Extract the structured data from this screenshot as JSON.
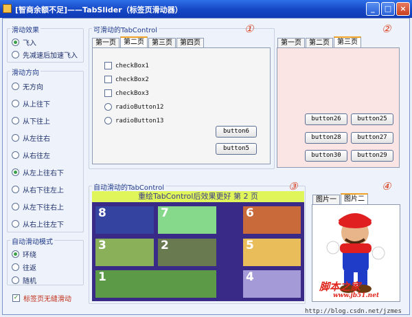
{
  "window": {
    "title": "[智商余额不足]——TabSlider（标签页滑动器）",
    "buttons": {
      "minimize": "_",
      "maximize": "□",
      "close": "×"
    }
  },
  "left": {
    "effect": {
      "title": "滑动效果",
      "options": [
        {
          "label": "飞入",
          "checked": true
        },
        {
          "label": "先减速后加速飞入",
          "checked": false
        }
      ]
    },
    "direction": {
      "title": "滑动方向",
      "options": [
        {
          "label": "无方向",
          "checked": false
        },
        {
          "label": "从上往下",
          "checked": false
        },
        {
          "label": "从下往上",
          "checked": false
        },
        {
          "label": "从左往右",
          "checked": false
        },
        {
          "label": "从右往左",
          "checked": false
        },
        {
          "label": "从左上往右下",
          "checked": true
        },
        {
          "label": "从右下往左上",
          "checked": false
        },
        {
          "label": "从左下往右上",
          "checked": false
        },
        {
          "label": "从右上往左下",
          "checked": false
        }
      ]
    },
    "mode": {
      "title": "自动滑动模式",
      "options": [
        {
          "label": "环绕",
          "checked": true
        },
        {
          "label": "往返",
          "checked": false
        },
        {
          "label": "随机",
          "checked": false
        }
      ]
    },
    "seamless": {
      "label": "标签页无缝滑动",
      "checked": true
    }
  },
  "panel1": {
    "title": "可滑动的TabControl",
    "number": "①",
    "tabs": [
      {
        "label": "第一页",
        "active": false
      },
      {
        "label": "第二页",
        "active": true
      },
      {
        "label": "第三页",
        "active": false
      },
      {
        "label": "第四页",
        "active": false
      }
    ],
    "controls": {
      "cb1": "checkBox1",
      "cb2": "checkBox2",
      "cb3": "checkBox3",
      "rb12": "radioButton12",
      "rb13": "radioButton13",
      "btn6": "button6",
      "btn5": "button5"
    }
  },
  "panel2": {
    "number": "②",
    "tabs": [
      {
        "label": "第一页",
        "active": false
      },
      {
        "label": "第二页",
        "active": false
      },
      {
        "label": "第三页",
        "active": true
      }
    ],
    "buttons": {
      "b26": "button26",
      "b25": "button25",
      "b28": "button28",
      "b27": "button27",
      "b30": "button30",
      "b29": "button29"
    }
  },
  "panel3": {
    "title": "自动滑动的TabControl",
    "number": "③",
    "header": "重绘TabControl后效果更好 第 2 页",
    "tiles": {
      "t8": "8",
      "t7": "7",
      "t6": "6",
      "t3": "3",
      "t2": "2",
      "t5": "5",
      "t1": "1",
      "t4": "4"
    }
  },
  "panel4": {
    "number": "④",
    "tabs": [
      {
        "label": "图片一",
        "active": false
      },
      {
        "label": "图片二",
        "active": true
      }
    ],
    "watermark": {
      "title": "脚本之家",
      "url": "www.jb51.net"
    }
  },
  "footer": {
    "url": "http://blog.csdn.net/jzmes"
  },
  "colors": {
    "titlebar": "#1546c4",
    "accent_number": "#d83a1a",
    "panel2_bg": "#fbe4e4",
    "panel3_header": "#dff55a",
    "panel3_bg": "#3a2a88"
  }
}
